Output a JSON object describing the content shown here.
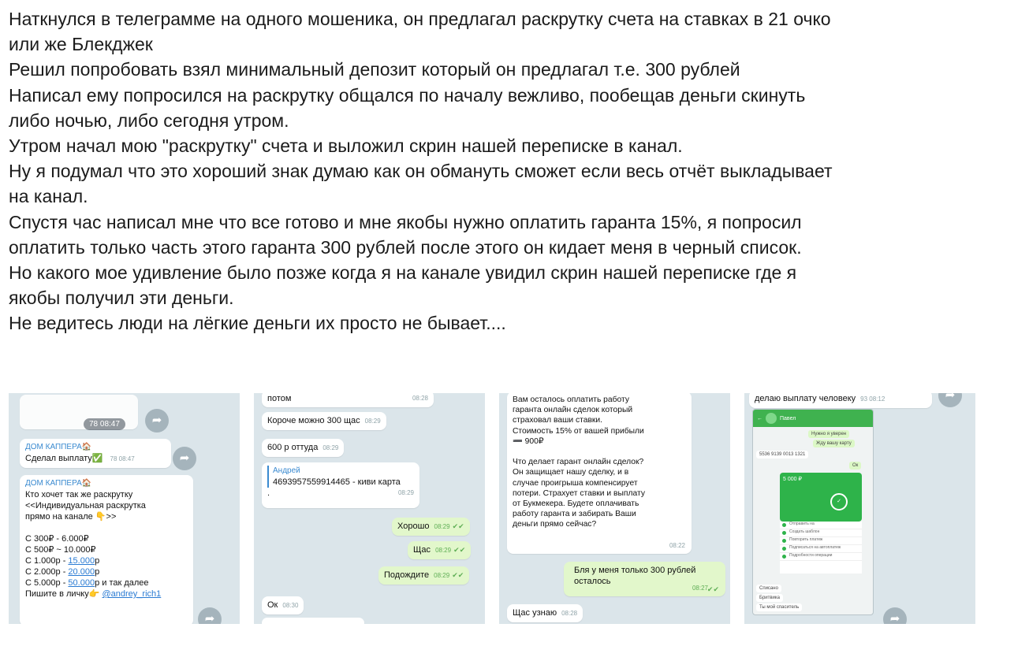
{
  "post": {
    "lines": [
      "Наткнулся в телеграмме на одного мошеника, он предлагал раскрутку счета на ставках в 21 очко",
      "или же Блекджек",
      "Решил попробовать взял минимальный депозит который он предлагал т.е. 300 рублей",
      "Написал ему попросился на раскрутку общался по началу вежливо, пообещав деньги скинуть",
      "либо ночью, либо сегодня утром.",
      "Утром начал мою \"раскрутку\" счета и выложил скрин нашей переписке в канал.",
      "Ну я подумал что это хороший знак думаю как он обмануть сможет если весь отчёт выкладывает",
      "на канал.",
      "Спустя час написал мне что все готово и мне якобы нужно оплатить гаранта 15%, я попросил",
      "оплатить только часть этого гаранта 300 рублей после этого он кидает меня в черный список.",
      "Но какого мое удивление было позже когда я на канале увидил скрин нашей переписке где я",
      "якобы получил эти деньги.",
      "Не ведитесь люди на лёгкие деньги их просто не бывает...."
    ]
  },
  "shot1": {
    "views1": "78  08:47",
    "sender1": "ДОМ КАППЕРА🏠",
    "msg1": "Сделал выплату✅",
    "meta1": "78  08:47",
    "sender2": "ДОМ КАППЕРА🏠",
    "promo": "Кто хочет так же раскрутку\n<<Индивидуальная раскрутка\nпрямо на канале 👇>>\n\nС 300₽ - 6.000₽\nС 500₽ ~ 10.000₽",
    "promo_l1_a": "С 1.000р - ",
    "promo_l1_b": "15.000",
    "promo_l1_c": "р",
    "promo_l2_a": "С 2.000р - ",
    "promo_l2_b": "20.000",
    "promo_l2_c": "р",
    "promo_l3_a": "С 5.000р - ",
    "promo_l3_b": "50.000",
    "promo_l3_c": "р и так далее",
    "promo_last_a": "Пишите в личку👉 ",
    "promo_last_b": "@andrey_rich1"
  },
  "shot2": {
    "m0": "потом",
    "t0": "08:28",
    "m1": "Короче можно 300 щас",
    "t1": "08:29",
    "m2": "600 р оттуда",
    "t2": "08:29",
    "card_name": "Андрей",
    "card_number": "4693957559914465 - киви карта",
    "card_dot": ".",
    "card_time": "08:29",
    "o1": "Хорошо",
    "ot1": "08:29",
    "o2": "Щас",
    "ot2": "08:29",
    "o3": "Подождите",
    "ot3": "08:29",
    "m3": "Ок",
    "t3": "08:30"
  },
  "shot3": {
    "long": "Вам осталось оплатить работу\nгаранта онлайн сделок который\nстраховал ваши ставки.\nСтоимость 15% от вашей прибыли\n➖ 900₽\n\nЧто делает гарант онлайн сделок?\nОн защищает нашу сделку, и в\nслучае проигрыша компенсирует\nпотери. Страхует ставки и выплату\nот Букмекера. Будете оплачивать\nработу гаранта и забирать Ваши\nденьги прямо сейчас?",
    "long_time": "08:22",
    "reply": "Бля у меня только 300 рублей\nосталось",
    "reply_time": "08:27",
    "m_last": "Щас узнаю",
    "m_last_time": "08:28"
  },
  "shot4": {
    "top": "делаю выплату человеку",
    "top_meta": "93  08:12",
    "contact": "Павел",
    "c1": "Нужно я уверен",
    "c2": "Жду вашу карту",
    "c3": "5536 9139 0013 1321",
    "c4": "Ок",
    "g1": "5 000 ₽",
    "l1": "Списано",
    "l2": "Бритвика",
    "l3": "Ты мой спаситель",
    "i1": "Отправить на",
    "i2": "Создать шаблон",
    "i3": "Повторить платеж",
    "i4": "Подписаться на автоплатеж",
    "i5": "Подробности операции"
  }
}
